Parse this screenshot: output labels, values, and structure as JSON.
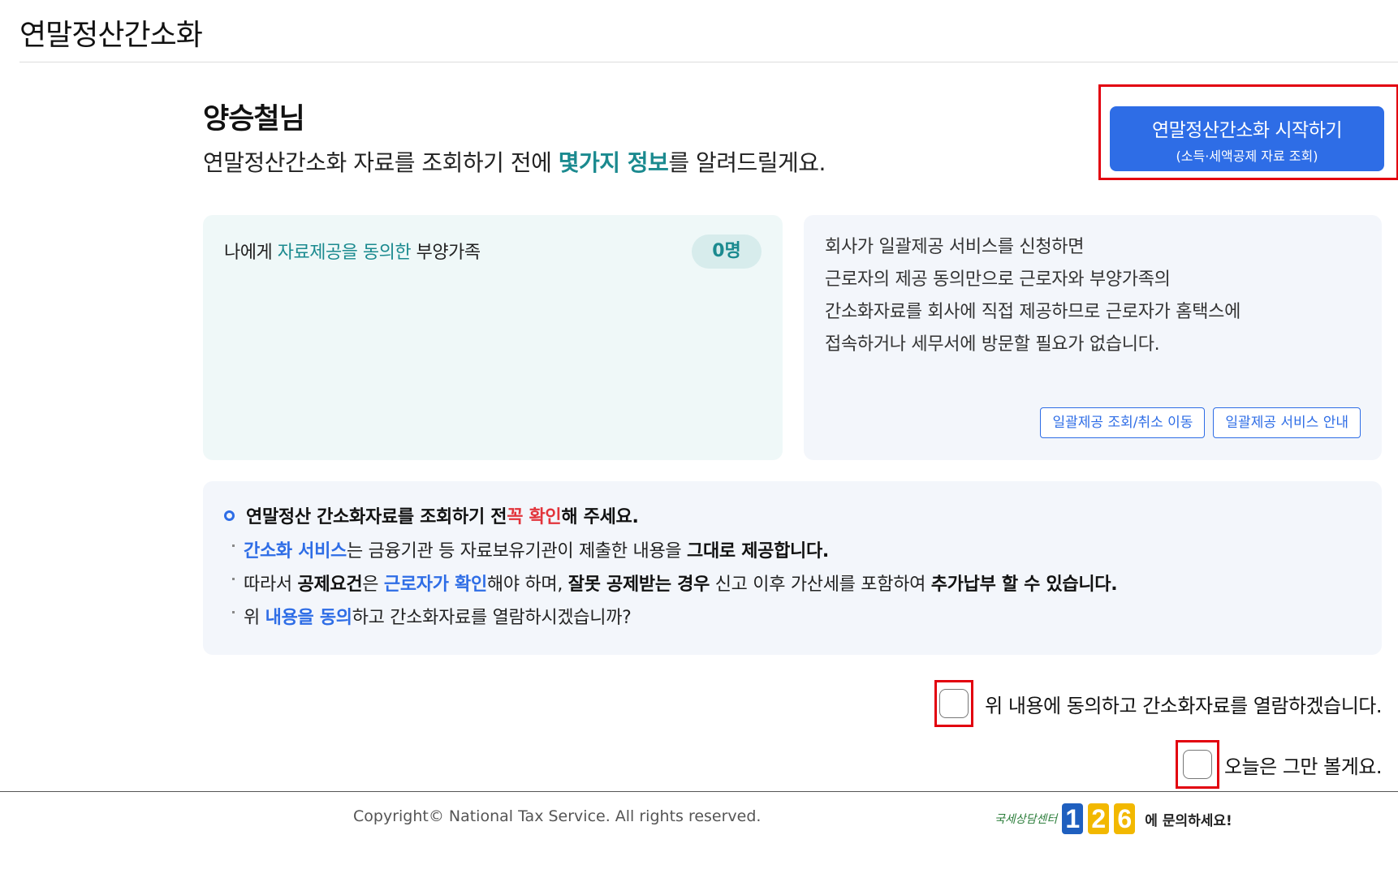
{
  "header": {
    "title": "연말정산간소화"
  },
  "greeting": {
    "user_name": "양승철님",
    "intro_before": "연말정산간소화 자료를 조회하기 전에 ",
    "intro_highlight": "몇가지 정보",
    "intro_after": "를 알려드릴게요."
  },
  "start_button": {
    "label": "연말정산간소화 시작하기",
    "sublabel": "(소득·세액공제 자료 조회)"
  },
  "dependents": {
    "label_before": "나에게 ",
    "label_highlight": "자료제공을 동의한",
    "label_after": " 부양가족",
    "count": "0명"
  },
  "batch_service": {
    "lines": [
      "회사가 일괄제공 서비스를 신청하면",
      "근로자의 제공 동의만으로 근로자와 부양가족의",
      "간소화자료를 회사에 직접 제공하므로 근로자가 홈택스에",
      "접속하거나 세무서에 방문할 필요가 없습니다."
    ],
    "lookup_button": "일괄제공 조회/취소 이동",
    "guide_button": "일괄제공 서비스 안내"
  },
  "notice": {
    "title_before": "연말정산 간소화자료를 조회하기 전 ",
    "title_highlight": "꼭 확인",
    "title_after": "해 주세요.",
    "item1_blue": "간소화 서비스",
    "item1_mid": "는 금융기관 등 자료보유기관이 제출한 내용을 ",
    "item1_bold": "그대로 제공합니다.",
    "item2_start": "따라서 ",
    "item2_bold1": "공제요건",
    "item2_mid1": "은 ",
    "item2_blue": "근로자가 확인",
    "item2_mid2": "해야 하며, ",
    "item2_bold2": "잘못 공제받는 경우",
    "item2_mid3": " 신고 이후 가산세를 포함하여 ",
    "item2_bold3": "추가납부 할 수 있습니다.",
    "item3_start": "위 ",
    "item3_blue": "내용을 동의",
    "item3_end": "하고 간소화자료를 열람하시겠습니까?"
  },
  "agreements": {
    "agree_label": "위 내용에 동의하고 간소화자료를 열람하겠습니다.",
    "dismiss_label": "오늘은 그만 볼게요."
  },
  "footer": {
    "copyright": "Copyright© National Tax Service. All rights reserved.",
    "contact_prefix": "국세상담센터",
    "contact_number": [
      "1",
      "2",
      "6"
    ],
    "contact_suffix": "에 문의하세요!"
  },
  "colors": {
    "accent_blue": "#2e6de6",
    "teal": "#1b8a8f",
    "highlight_red": "#e2000f"
  }
}
